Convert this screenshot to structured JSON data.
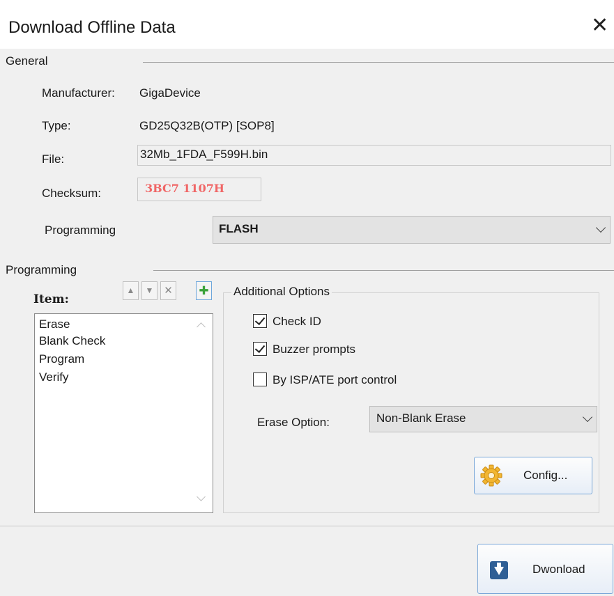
{
  "window": {
    "title": "Download Offline Data",
    "close_symbol": "✕"
  },
  "general": {
    "section_label": "General",
    "manufacturer_label": "Manufacturer:",
    "manufacturer_value": "GigaDevice",
    "type_label": "Type:",
    "type_value": "GD25Q32B(OTP) [SOP8]",
    "file_label": "File:",
    "file_value": "32Mb_1FDA_F599H.bin",
    "checksum_label": "Checksum:",
    "checksum_value": "3BC7 1107H",
    "checksum_color": "#f06666",
    "programming_label": "Programming",
    "programming_value": "FLASH"
  },
  "programming": {
    "section_label": "Programming",
    "item_label": "Item:",
    "toolbar_icons": [
      "arrow-up-icon",
      "arrow-down-icon",
      "delete-x-icon",
      "add-plus-icon"
    ],
    "items": [
      "Erase",
      "Blank Check",
      "Program",
      "Verify"
    ]
  },
  "additional_options": {
    "label": "Additional Options",
    "options": [
      {
        "label": "Check ID",
        "checked": true
      },
      {
        "label": "Buzzer prompts",
        "checked": true
      },
      {
        "label": "By ISP/ATE port control",
        "checked": false
      }
    ],
    "erase_option_label": "Erase Option:",
    "erase_option_value": "Non-Blank Erase",
    "config_label": "Config..."
  },
  "footer": {
    "download_label": "Dwonload"
  }
}
